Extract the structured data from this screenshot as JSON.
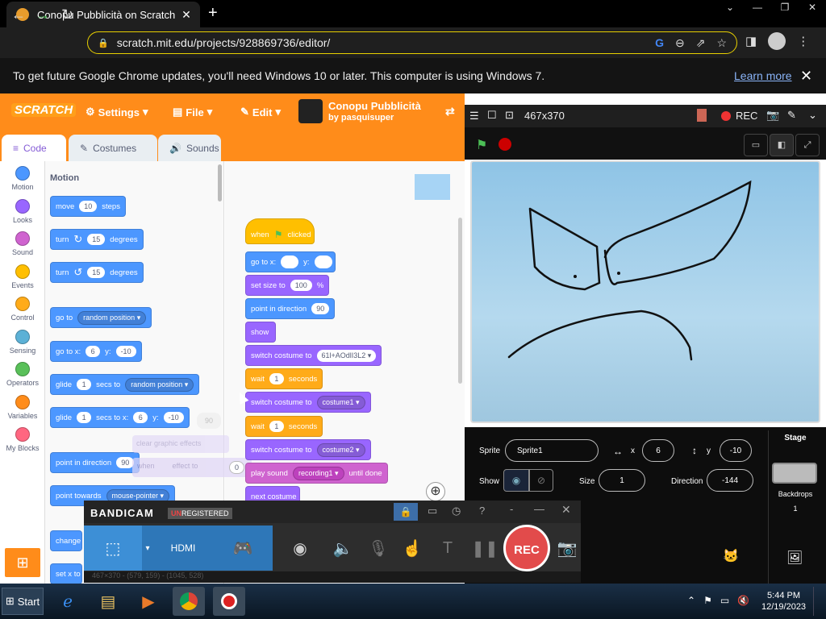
{
  "browser": {
    "tab_title": "Conopu Pubblicità on Scratch",
    "tab_close": "✕",
    "new_tab": "+",
    "window_controls": [
      "⌄",
      "—",
      "❐",
      "✕"
    ],
    "url": "scratch.mit.edu/projects/928869736/editor/",
    "infobar_text": "To get future Google Chrome updates, you'll need Windows 10 or later. This computer is using Windows 7.",
    "infobar_link": "Learn more"
  },
  "scratch": {
    "logo": "SCRATCH",
    "menu": {
      "settings": "Settings",
      "file": "File",
      "edit": "Edit"
    },
    "project_title": "Conopu Pubblicità",
    "project_by": "by pasquisuper",
    "tabs": {
      "code": "Code",
      "costumes": "Costumes",
      "sounds": "Sounds"
    },
    "categories": [
      {
        "label": "Motion",
        "color": "#4c97ff"
      },
      {
        "label": "Looks",
        "color": "#9966ff"
      },
      {
        "label": "Sound",
        "color": "#cf63cf"
      },
      {
        "label": "Events",
        "color": "#ffbf00"
      },
      {
        "label": "Control",
        "color": "#ffab19"
      },
      {
        "label": "Sensing",
        "color": "#5cb1d6"
      },
      {
        "label": "Operators",
        "color": "#59c059"
      },
      {
        "label": "Variables",
        "color": "#ff8c1a"
      },
      {
        "label": "My Blocks",
        "color": "#ff6680"
      }
    ],
    "palette": {
      "heading": "Motion",
      "move": {
        "a": "move",
        "v": "10",
        "b": "steps"
      },
      "turn_cw": {
        "a": "turn",
        "v": "15",
        "b": "degrees"
      },
      "turn_ccw": {
        "a": "turn",
        "v": "15",
        "b": "degrees"
      },
      "goto_random": {
        "a": "go to",
        "d": "random position"
      },
      "goto_xy": {
        "a": "go to x:",
        "x": "6",
        "b": "y:",
        "y": "-10"
      },
      "glide_random": {
        "a": "glide",
        "v": "1",
        "b": "secs to",
        "d": "random position"
      },
      "glide_xy": {
        "a": "glide",
        "v": "1",
        "b": "secs to x:",
        "x": "6",
        "c": "y:",
        "y": "-10"
      },
      "point_dir": {
        "a": "point in direction",
        "v": "90"
      },
      "point_towards": {
        "a": "point towards",
        "d": "mouse-pointer"
      },
      "change": {
        "a": "change"
      },
      "setx": {
        "a": "set x to"
      }
    },
    "script": {
      "when_flag": {
        "a": "when",
        "b": "clicked"
      },
      "goto": {
        "a": "go to x:",
        "b": "y:"
      },
      "size": {
        "a": "set size to",
        "v": "100",
        "b": "%"
      },
      "dir": {
        "a": "point in direction",
        "v": "90"
      },
      "show": "show",
      "costume1": {
        "a": "switch costume to",
        "d": "61l+AOdlI3L2"
      },
      "wait1": {
        "a": "wait",
        "v": "1",
        "b": "seconds"
      },
      "costume2": {
        "a": "switch costume to",
        "d": "costume1"
      },
      "wait2": {
        "a": "wait",
        "v": "1",
        "b": "seconds"
      },
      "costume3": {
        "a": "switch costume to",
        "d": "costume2"
      },
      "sound": {
        "a": "play sound",
        "d": "recording1",
        "b": "until done"
      },
      "next": "next costume",
      "ghost_clear": "clear graphic effects",
      "ghost_effect_val": "0",
      "ghost_effect_label": "effect to",
      "ghost_when": "when",
      "ghost_val": "90"
    },
    "stage_header": {
      "size": "467x370",
      "rec": "REC"
    },
    "sprite": {
      "sprite_label": "Sprite",
      "sprite_name": "Sprite1",
      "x_label": "x",
      "x": "6",
      "y_label": "y",
      "y": "-10",
      "show_label": "Show",
      "size_label": "Size",
      "size": "1",
      "direction_label": "Direction",
      "direction": "-144"
    },
    "stage_panel": {
      "title": "Stage",
      "backdrops_label": "Backdrops",
      "backdrops_count": "1"
    }
  },
  "bandicam": {
    "logo": "BANDICAM",
    "unreg_prefix": "UN",
    "unreg_rest": "REGISTERED",
    "hdmi": "HDMI",
    "rec": "REC",
    "footer": "467×370 - (579, 159) - (1045, 528)"
  },
  "taskbar": {
    "start": "Start",
    "time": "5:44 PM",
    "date": "12/19/2023"
  },
  "colors": {
    "scratch_orange": "#ff8c1a",
    "chrome_dark": "#1f1f1f",
    "omnibox_border": "#e8d000"
  }
}
